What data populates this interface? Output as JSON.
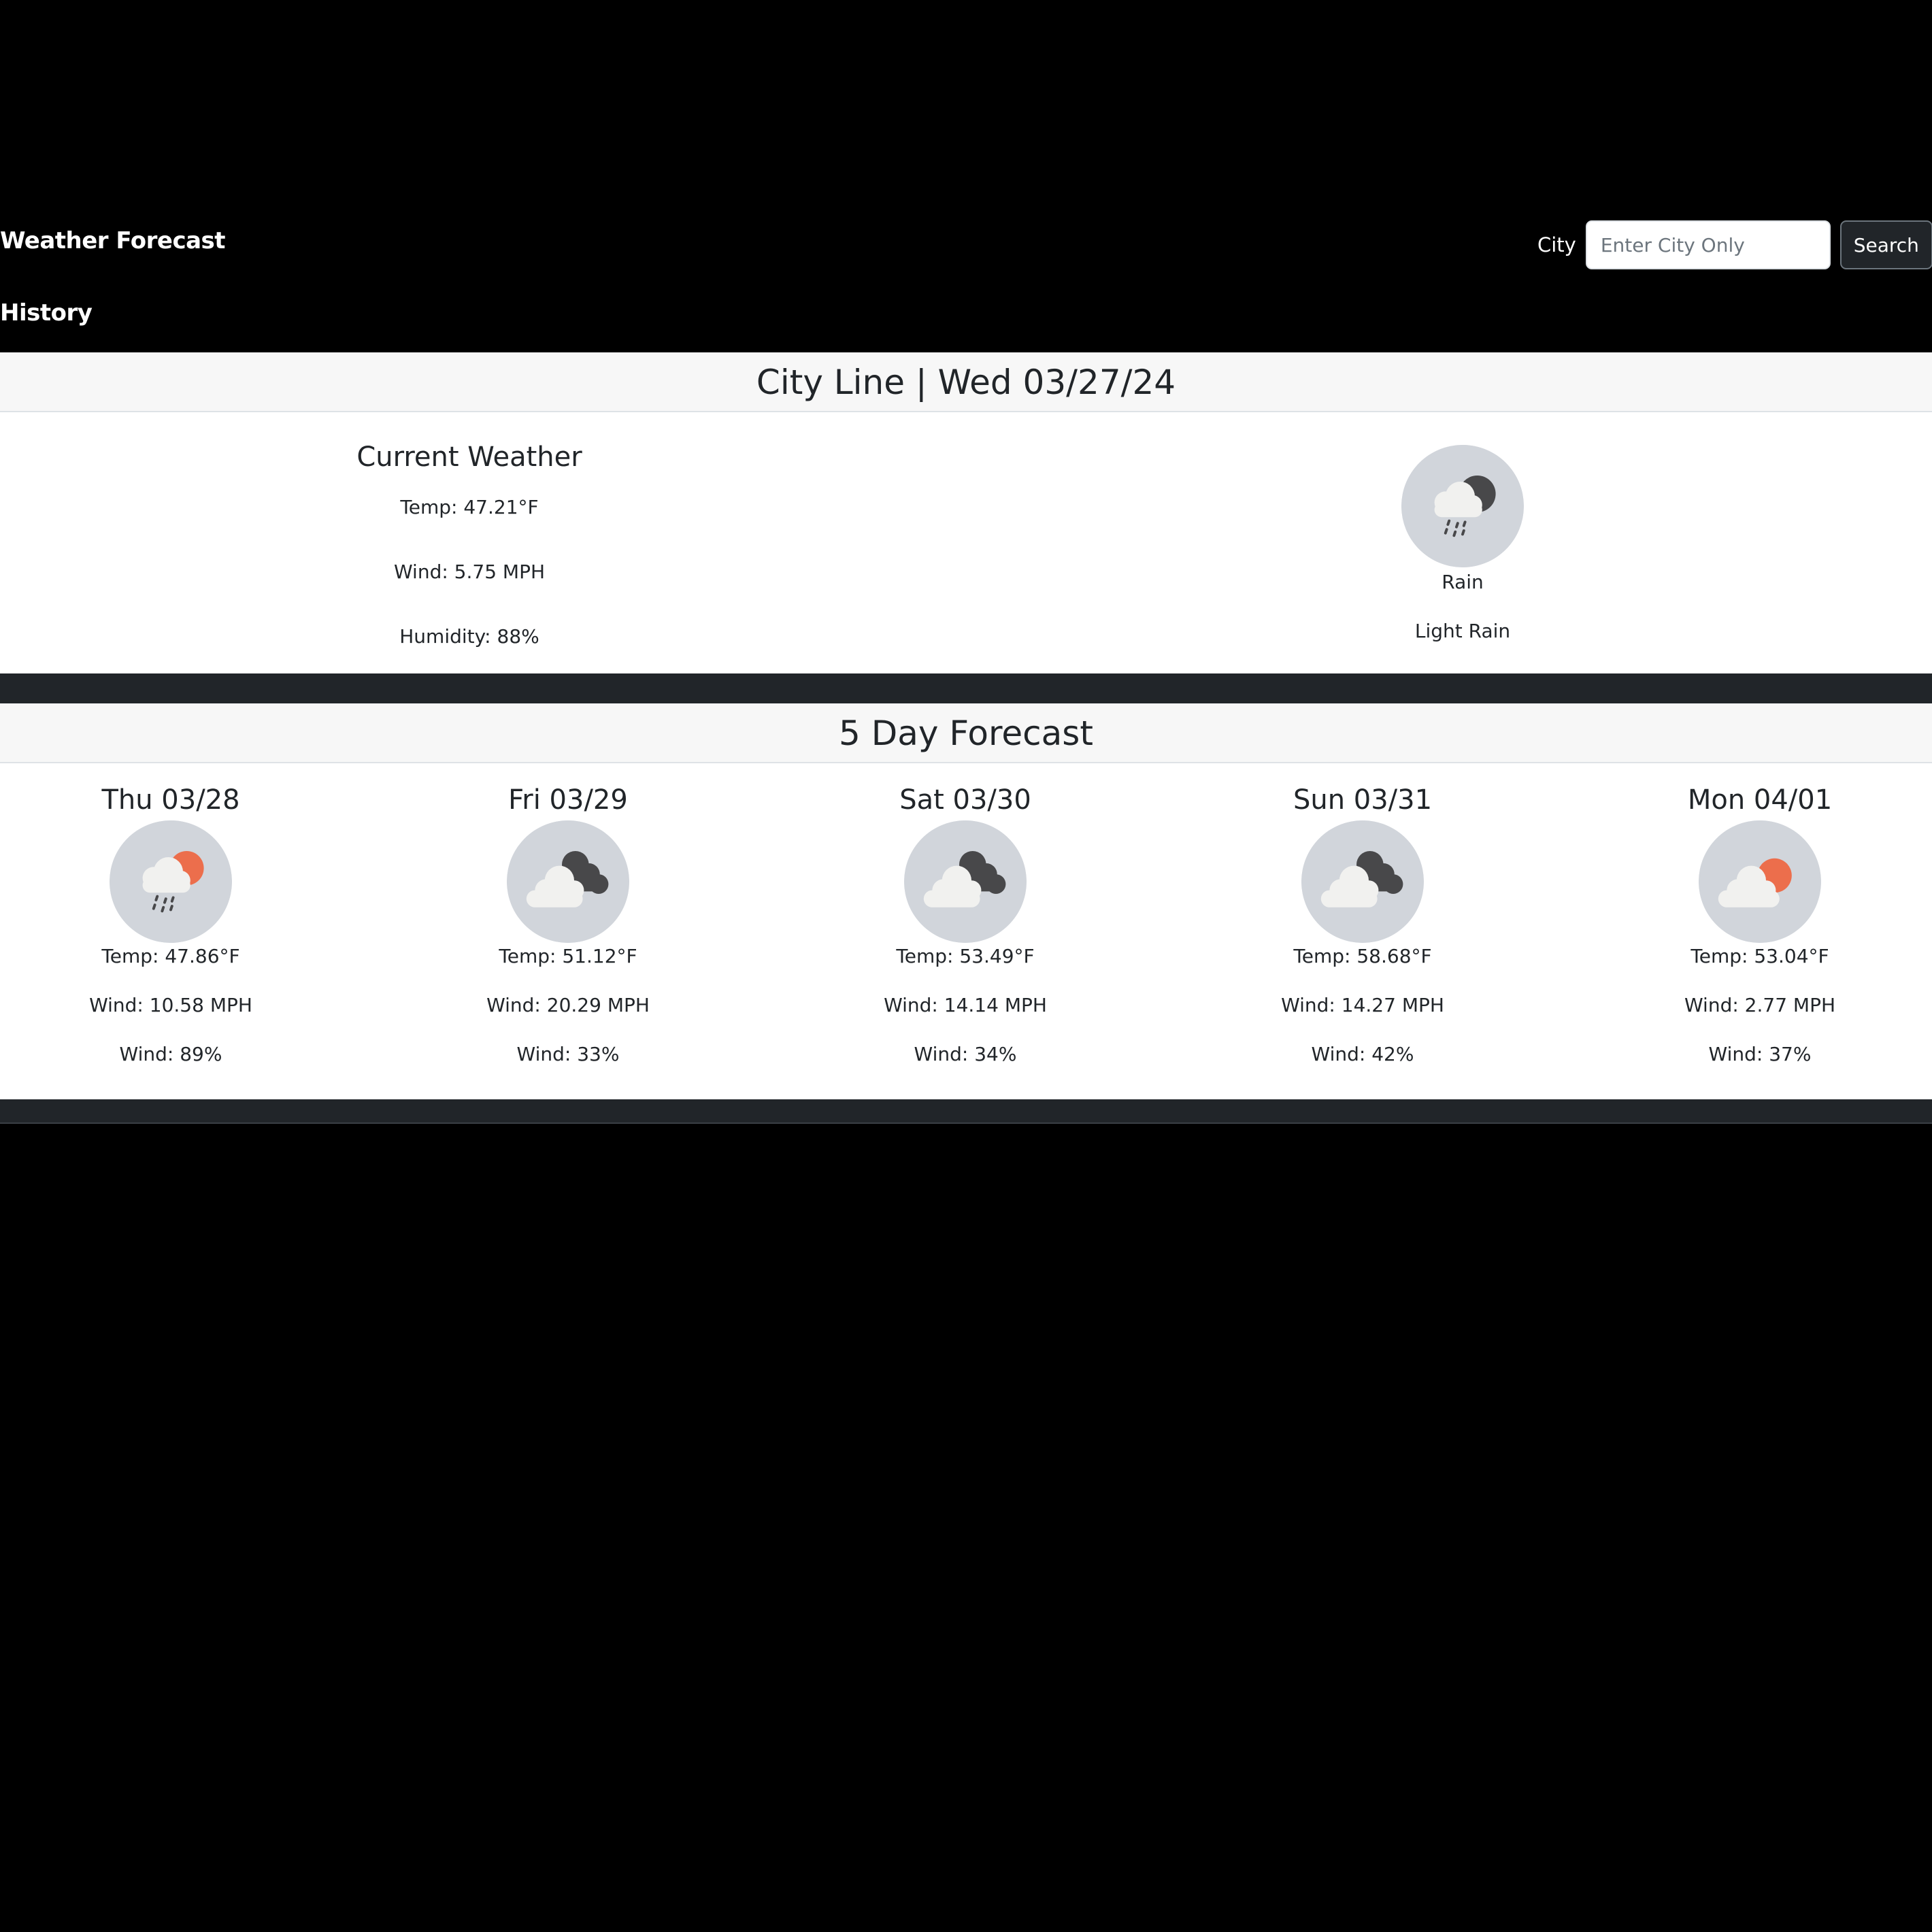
{
  "header": {
    "app_title": "Weather Forecast",
    "history_label": "History"
  },
  "search": {
    "label": "City",
    "placeholder": "Enter City Only",
    "value": "",
    "button_label": "Search"
  },
  "current": {
    "header": "City Line | Wed 03/27/24",
    "heading": "Current Weather",
    "temp": "Temp: 47.21°F",
    "wind": "Wind: 5.75 MPH",
    "humidity": "Humidity: 88%",
    "icon": "rain-night-icon",
    "description": "Rain",
    "detail": "Light Rain"
  },
  "forecast": {
    "header": "5 Day Forecast",
    "days": [
      {
        "date": "Thu 03/28",
        "icon": "rain-day-icon",
        "temp": "Temp: 47.86°F",
        "wind": "Wind: 10.58 MPH",
        "humidity": "Wind: 89%"
      },
      {
        "date": "Fri 03/29",
        "icon": "broken-clouds-icon",
        "temp": "Temp: 51.12°F",
        "wind": "Wind: 20.29 MPH",
        "humidity": "Wind: 33%"
      },
      {
        "date": "Sat 03/30",
        "icon": "broken-clouds-icon",
        "temp": "Temp: 53.49°F",
        "wind": "Wind: 14.14 MPH",
        "humidity": "Wind: 34%"
      },
      {
        "date": "Sun 03/31",
        "icon": "broken-clouds-icon",
        "temp": "Temp: 58.68°F",
        "wind": "Wind: 14.27 MPH",
        "humidity": "Wind: 42%"
      },
      {
        "date": "Mon 04/01",
        "icon": "partly-cloudy-day-icon",
        "temp": "Temp: 53.04°F",
        "wind": "Wind: 2.77 MPH",
        "humidity": "Wind: 37%"
      }
    ]
  },
  "colors": {
    "page_bg": "#000000",
    "band": "#212529",
    "card_header_bg": "#f7f7f7",
    "icon_bg": "#d1d5db",
    "sun": "#ec6e4c",
    "dark_cloud": "#48484a",
    "light_cloud": "#f1f1ef"
  }
}
